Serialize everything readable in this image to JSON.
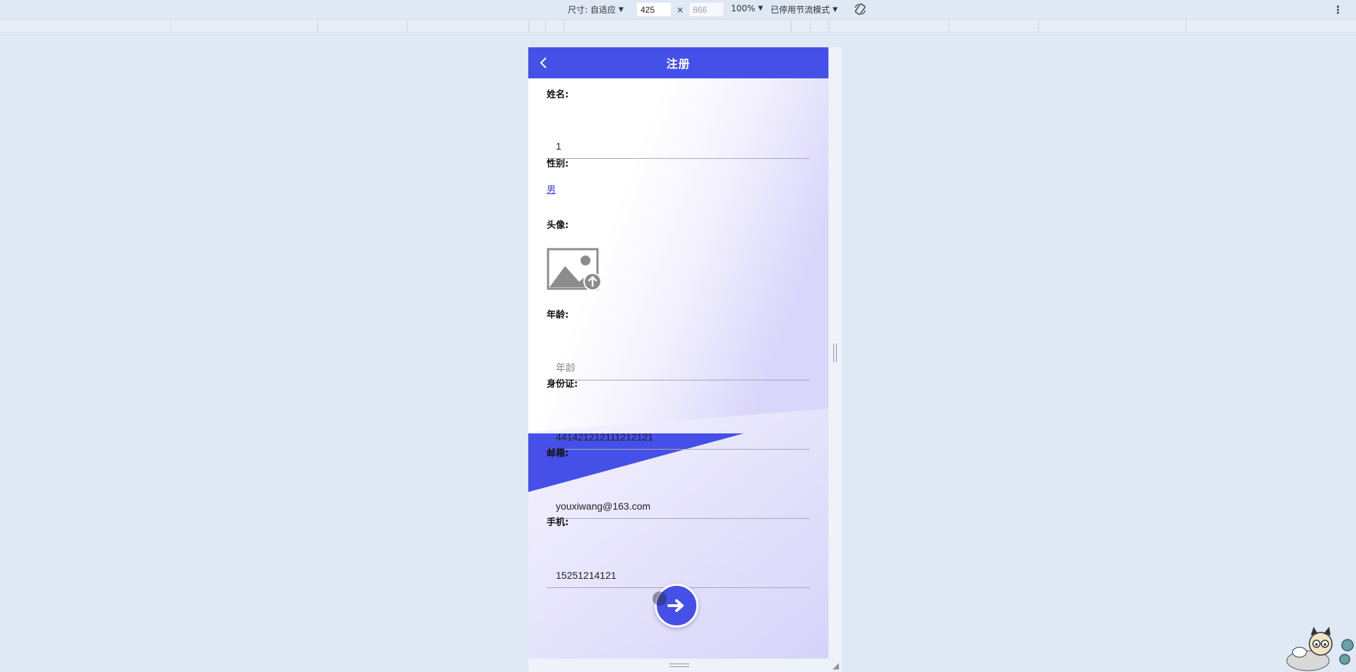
{
  "devtools": {
    "size_label": "尺寸: 自适应",
    "width_value": "425",
    "times": "×",
    "height_value": "866",
    "zoom_label": "100%",
    "throttle_label": "已停用节流模式",
    "more_icon": "more-vertical-icon",
    "rotate_icon": "rotate-device-icon"
  },
  "app": {
    "header": {
      "title": "注册",
      "back_icon": "chevron-left-icon"
    },
    "form": {
      "name_label": "姓名:",
      "name_value": "1",
      "gender_label": "性别:",
      "gender_value": "男",
      "avatar_label": "头像:",
      "avatar_icon": "image-upload-icon",
      "age_label": "年龄:",
      "age_placeholder": "年龄",
      "idcard_label": "身份证:",
      "idcard_value": "441421212111212121",
      "email_label": "邮箱:",
      "email_value": "youxiwang@163.com",
      "phone_label": "手机:",
      "phone_value": "15251214121",
      "submit_icon": "arrow-right-icon"
    }
  },
  "colors": {
    "primary": "#4450e8",
    "page_bg": "#dfe8f5"
  }
}
